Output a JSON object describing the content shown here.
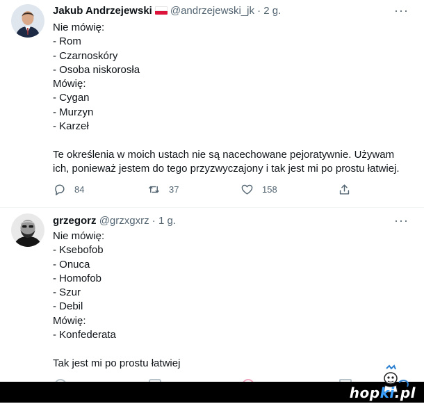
{
  "tweets": [
    {
      "author_name": "Jakub Andrzejewski",
      "handle": "@andrzejewski_jk",
      "separator": "·",
      "time": "2 g.",
      "more_label": "···",
      "lines": [
        "Nie mówię:",
        "- Rom",
        "- Czarnoskóry",
        "- Osoba niskorosła",
        "Mówię:",
        "- Cygan",
        "- Murzyn",
        "- Karzeł",
        "",
        "Te określenia w moich ustach nie są nacechowane pejoratywnie. Używam",
        "ich, ponieważ jestem do tego przyzwyczajony i tak jest mi po prostu łatwiej."
      ],
      "replies": "84",
      "retweets": "37",
      "likes": "158"
    },
    {
      "author_name": "grzegorz",
      "handle": "@grzxgxrz",
      "separator": "·",
      "time": "1 g.",
      "more_label": "···",
      "lines": [
        "Nie mówię:",
        "- Ksebofob",
        "- Onuca",
        "- Homofob",
        "- Szur",
        "- Debil",
        "Mówię:",
        "- Konfederata",
        "",
        "Tak jest mi po prostu łatwiej"
      ]
    }
  ],
  "watermark": {
    "part1": "hop",
    "part2": "ki",
    "suffix": ".pl"
  },
  "colors": {
    "text": "#0f1419",
    "muted": "#536471",
    "flag_white": "#ffffff",
    "flag_red": "#dc143c"
  }
}
